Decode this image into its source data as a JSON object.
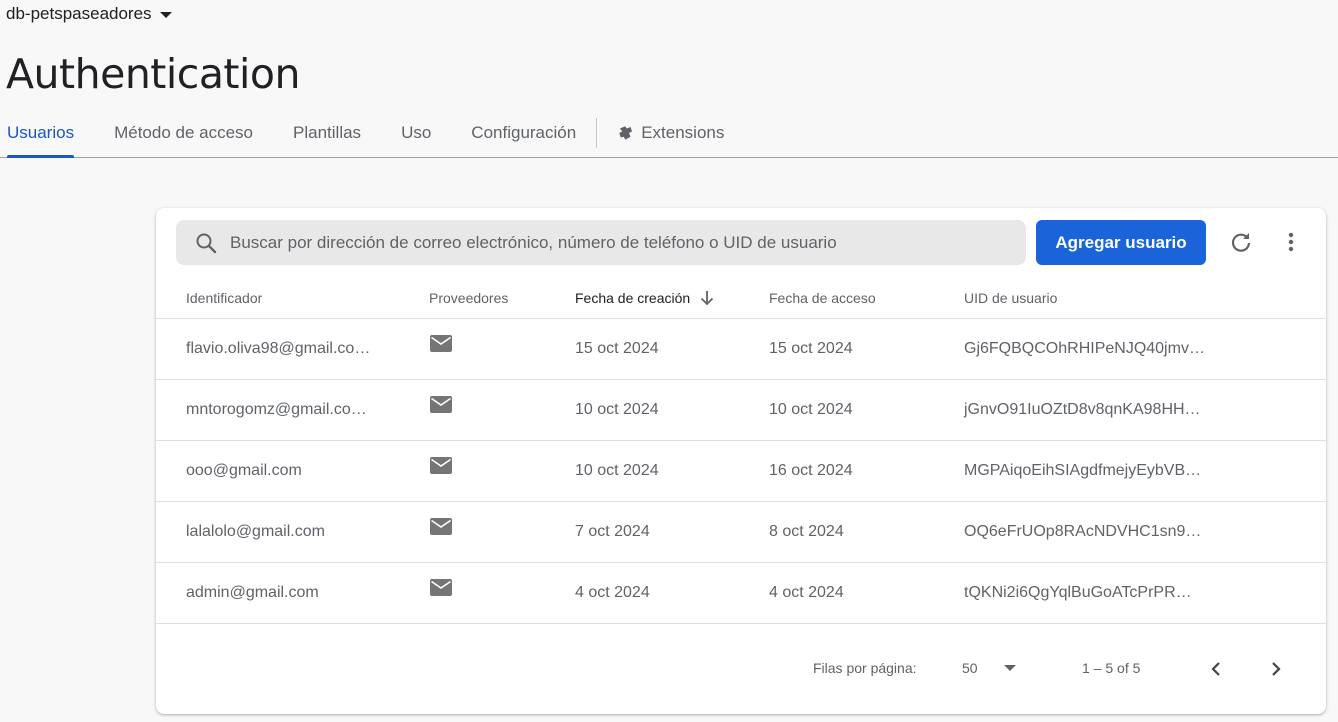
{
  "project": {
    "name": "db-petspaseadores"
  },
  "page": {
    "title": "Authentication"
  },
  "tabs": [
    {
      "label": "Usuarios",
      "active": true
    },
    {
      "label": "Método de acceso"
    },
    {
      "label": "Plantillas"
    },
    {
      "label": "Uso"
    },
    {
      "label": "Configuración"
    },
    {
      "label": "Extensions",
      "icon": "extension-icon"
    }
  ],
  "toolbar": {
    "search_placeholder": "Buscar por dirección de correo electrónico, número de teléfono o UID de usuario",
    "add_user_label": "Agregar usuario",
    "icons": [
      "search-icon",
      "refresh-icon",
      "more-vert-icon"
    ]
  },
  "table": {
    "columns": [
      "Identificador",
      "Proveedores",
      "Fecha de creación",
      "Fecha de acceso",
      "UID de usuario"
    ],
    "sorted_column": "Fecha de creación",
    "rows": [
      {
        "id": "flavio.oliva98@gmail.co…",
        "provider": "email-icon",
        "created": "15 oct 2024",
        "accessed": "15 oct 2024",
        "uid": "Gj6FQBQCOhRHIPeNJQ40jmv…"
      },
      {
        "id": "mntorogomz@gmail.co…",
        "provider": "email-icon",
        "created": "10 oct 2024",
        "accessed": "10 oct 2024",
        "uid": "jGnvO91IuOZtD8v8qnKA98HH…"
      },
      {
        "id": "ooo@gmail.com",
        "provider": "email-icon",
        "created": "10 oct 2024",
        "accessed": "16 oct 2024",
        "uid": "MGPAiqoEihSIAgdfmejyEybVB…"
      },
      {
        "id": "lalalolo@gmail.com",
        "provider": "email-icon",
        "created": "7 oct 2024",
        "accessed": "8 oct 2024",
        "uid": "OQ6eFrUOp8RAcNDVHC1sn9…"
      },
      {
        "id": "admin@gmail.com",
        "provider": "email-icon",
        "created": "4 oct 2024",
        "accessed": "4 oct 2024",
        "uid": "tQKNi2i6QgYqlBuGoATcPrPR…"
      }
    ]
  },
  "pagination": {
    "rows_per_page_label": "Filas por página:",
    "rows_per_page_value": "50",
    "range": "1 – 5 of 5"
  },
  "colors": {
    "accent": "#1a56c4",
    "button": "#1a63d8"
  }
}
